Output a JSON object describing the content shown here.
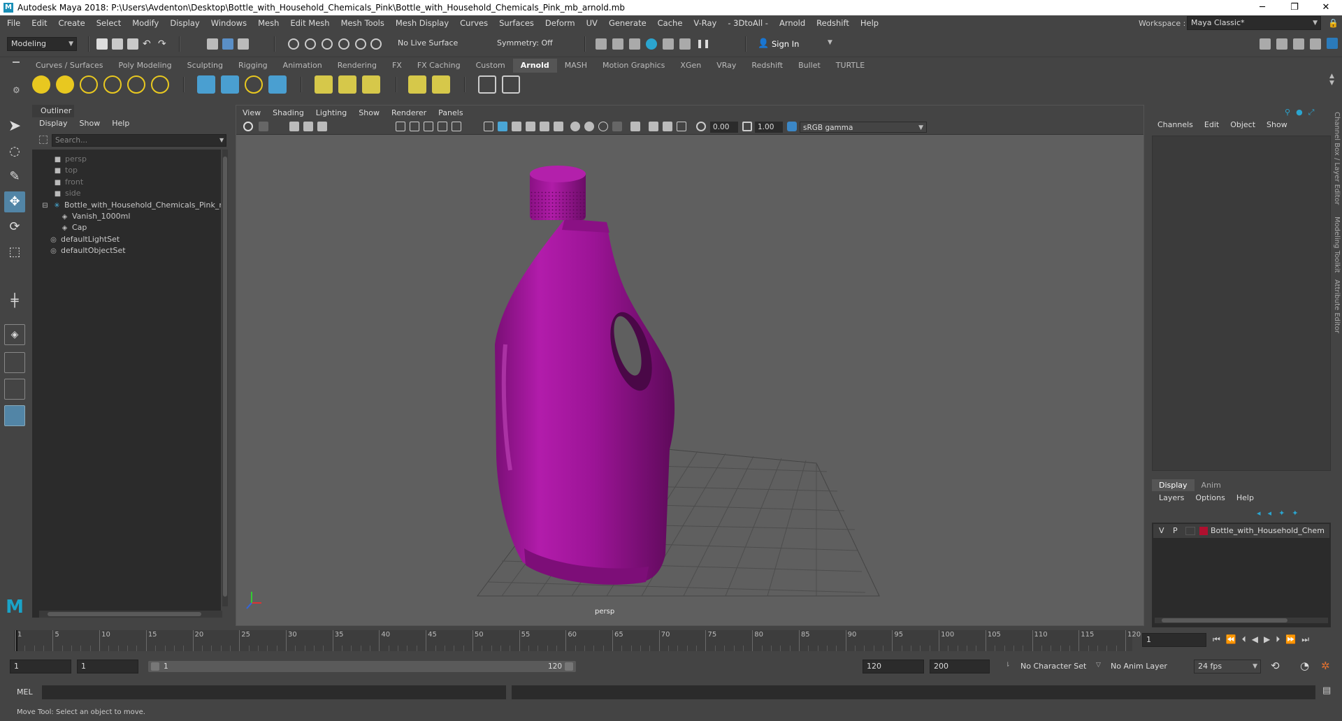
{
  "window": {
    "title": "Autodesk Maya 2018: P:\\Users\\Avdenton\\Desktop\\Bottle_with_Household_Chemicals_Pink\\Bottle_with_Household_Chemicals_Pink_mb_arnold.mb",
    "logo_letter": "M",
    "minimize": "─",
    "maximize": "❐",
    "close": "✕"
  },
  "menubar": {
    "items": [
      "File",
      "Edit",
      "Create",
      "Select",
      "Modify",
      "Display",
      "Windows",
      "Mesh",
      "Edit Mesh",
      "Mesh Tools",
      "Mesh Display",
      "Curves",
      "Surfaces",
      "Deform",
      "UV",
      "Generate",
      "Cache",
      "V-Ray",
      "- 3DtoAll -",
      "Arnold",
      "Redshift",
      "Help"
    ],
    "workspace_label": "Workspace :",
    "workspace_value": "Maya Classic*"
  },
  "statusline": {
    "mode": "Modeling",
    "live_surface": "No Live Surface",
    "symmetry": "Symmetry: Off",
    "sign_in": "Sign In"
  },
  "shelf": {
    "tabs": [
      "Curves / Surfaces",
      "Poly Modeling",
      "Sculpting",
      "Rigging",
      "Animation",
      "Rendering",
      "FX",
      "FX Caching",
      "Custom",
      "Arnold",
      "MASH",
      "Motion Graphics",
      "XGen",
      "VRay",
      "Redshift",
      "Bullet",
      "TURTLE"
    ],
    "active_tab": "Arnold"
  },
  "outliner": {
    "title": "Outliner",
    "menu": [
      "Display",
      "Show",
      "Help"
    ],
    "search_placeholder": "Search...",
    "items": [
      {
        "label": "persp",
        "icon": "camera-icon",
        "dim": true
      },
      {
        "label": "top",
        "icon": "camera-icon",
        "dim": true
      },
      {
        "label": "front",
        "icon": "camera-icon",
        "dim": true
      },
      {
        "label": "side",
        "icon": "camera-icon",
        "dim": true
      },
      {
        "label": "Bottle_with_Household_Chemicals_Pink_r",
        "icon": "group-icon",
        "dim": false
      },
      {
        "label": "Vanish_1000ml",
        "icon": "mesh-icon",
        "dim": false
      },
      {
        "label": "Cap",
        "icon": "mesh-icon",
        "dim": false
      },
      {
        "label": "defaultLightSet",
        "icon": "set-icon",
        "dim": false
      },
      {
        "label": "defaultObjectSet",
        "icon": "set-icon",
        "dim": false
      }
    ]
  },
  "viewport": {
    "menu": [
      "View",
      "Shading",
      "Lighting",
      "Show",
      "Renderer",
      "Panels"
    ],
    "exposure": "0.00",
    "gamma": "1.00",
    "color_space": "sRGB gamma",
    "camera_label": "persp",
    "bottle_color": "#9c1496"
  },
  "channelbox": {
    "menu": [
      "Channels",
      "Edit",
      "Object",
      "Show"
    ],
    "layer_tabs": [
      "Display",
      "Anim"
    ],
    "layer_menu": [
      "Layers",
      "Options",
      "Help"
    ],
    "layer": {
      "v": "V",
      "p": "P",
      "name": "Bottle_with_Household_Chem",
      "color": "#b0102f"
    },
    "side_tabs": [
      "Channel Box / Layer Editor",
      "Modeling Toolkit",
      "Attribute Editor"
    ]
  },
  "timeslider": {
    "ticks": [
      "1",
      "5",
      "10",
      "15",
      "20",
      "25",
      "30",
      "35",
      "40",
      "45",
      "50",
      "55",
      "60",
      "65",
      "70",
      "75",
      "80",
      "85",
      "90",
      "95",
      "100",
      "105",
      "110",
      "115",
      "120"
    ],
    "current_frame": "1"
  },
  "range": {
    "start": "1",
    "current": "1",
    "range_start": "1",
    "range_end": "120",
    "end": "120",
    "max_end": "200",
    "char_set": "No Character Set",
    "anim_layer": "No Anim Layer",
    "fps": "24 fps"
  },
  "cmd": {
    "lang": "MEL",
    "help": "Move Tool: Select an object to move."
  }
}
